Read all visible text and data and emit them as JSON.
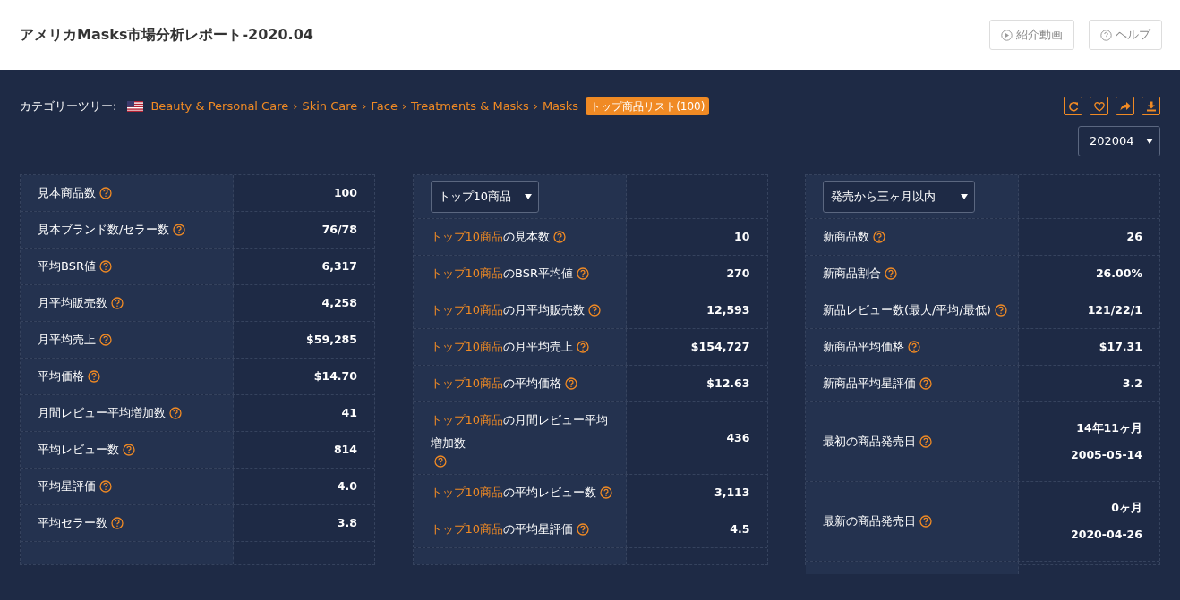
{
  "header": {
    "title": "アメリカMasks市場分析レポート-2020.04",
    "buttons": [
      {
        "kind": "video",
        "label": "紹介動画"
      },
      {
        "kind": "help",
        "label": "ヘルプ"
      }
    ]
  },
  "category": {
    "label": "カテゴリーツリー:",
    "separator": "›",
    "path": [
      "Beauty & Personal Care",
      "Skin Care",
      "Face",
      "Treatments & Masks",
      "Masks"
    ],
    "badge": "トップ商品リスト(100)"
  },
  "tools": [
    {
      "kind": "refresh"
    },
    {
      "kind": "heart"
    },
    {
      "kind": "share"
    },
    {
      "kind": "download"
    }
  ],
  "period": {
    "value": "202004"
  },
  "panels": [
    {
      "rows": [
        {
          "label": "見本商品数",
          "values": [
            "100"
          ]
        },
        {
          "label": "見本ブランド数/セラー数",
          "values": [
            "76/78"
          ]
        },
        {
          "label": "平均BSR値",
          "values": [
            "6,317"
          ]
        },
        {
          "label": "月平均販売数",
          "values": [
            "4,258"
          ]
        },
        {
          "label": "月平均売上",
          "values": [
            "$59,285"
          ]
        },
        {
          "label": "平均価格",
          "values": [
            "$14.70"
          ]
        },
        {
          "label": "月間レビュー平均増加数",
          "values": [
            "41"
          ]
        },
        {
          "label": "平均レビュー数",
          "values": [
            "814"
          ]
        },
        {
          "label": "平均星評価",
          "values": [
            "4.0"
          ]
        },
        {
          "label": "平均セラー数",
          "values": [
            "3.8"
          ]
        }
      ]
    },
    {
      "select": "トップ10商品",
      "rows": [
        {
          "highlight": "トップ10商品",
          "label": "の見本数",
          "values": [
            "10"
          ]
        },
        {
          "highlight": "トップ10商品",
          "label": "のBSR平均値",
          "values": [
            "270"
          ]
        },
        {
          "highlight": "トップ10商品",
          "label": "の月平均販売数",
          "values": [
            "12,593"
          ]
        },
        {
          "highlight": "トップ10商品",
          "label": "の月平均売上",
          "values": [
            "$154,727"
          ]
        },
        {
          "highlight": "トップ10商品",
          "label": "の平均価格",
          "values": [
            "$12.63"
          ]
        },
        {
          "highlight": "トップ10商品",
          "label": "の月間レビュー平均増加数",
          "values": [
            "436"
          ]
        },
        {
          "highlight": "トップ10商品",
          "label": "の平均レビュー数",
          "values": [
            "3,113"
          ]
        },
        {
          "highlight": "トップ10商品",
          "label": "の平均星評価",
          "values": [
            "4.5"
          ]
        }
      ]
    },
    {
      "select": "発売から三ヶ月以内",
      "rows": [
        {
          "label": "新商品数",
          "values": [
            "26"
          ]
        },
        {
          "label": "新商品割合",
          "values": [
            "26.00%"
          ]
        },
        {
          "label": "新品レビュー数(最大/平均/最低)",
          "values": [
            "121/22/1"
          ]
        },
        {
          "label": "新商品平均価格",
          "values": [
            "$17.31"
          ]
        },
        {
          "label": "新商品平均星評価",
          "values": [
            "3.2"
          ]
        },
        {
          "label": "最初の商品発売日",
          "values": [
            "14年11ヶ月",
            "2005-05-14"
          ]
        },
        {
          "label": "最新の商品発売日",
          "values": [
            "0ヶ月",
            "2020-04-26"
          ]
        }
      ]
    }
  ]
}
